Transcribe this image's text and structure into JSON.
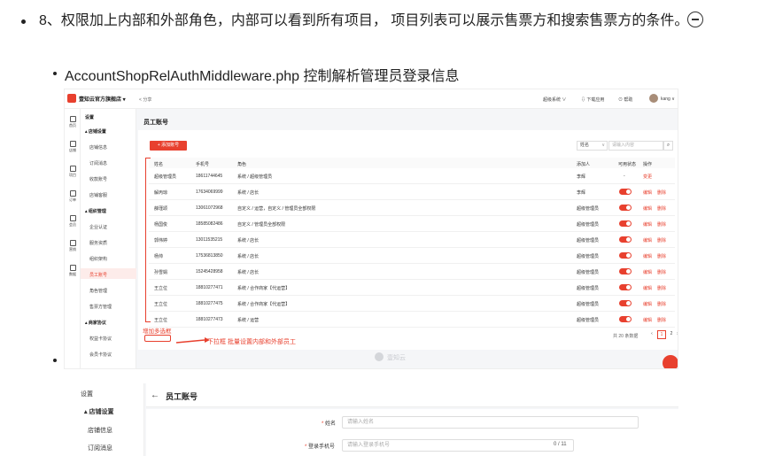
{
  "doc": {
    "item8_text": "8、权限加上内部和外部角色，内部可以看到所有项目， 项目列表可以展示售票方和搜索售票方的条件。",
    "item_sub_text": "AccountShopRelAuthMiddleware.php  控制解析管理员登录信息"
  },
  "shot1": {
    "shop_name": "壹知云官方旗舰店 ▾",
    "share": "分享",
    "top_right": [
      "超级系统 ∨",
      "下载应用",
      "帮助",
      "kang ∨"
    ],
    "icon_nav": [
      "首页",
      "店铺",
      "项目",
      "订单",
      "会员",
      "营销",
      "数据"
    ],
    "menu": {
      "title": "设置",
      "groups": [
        {
          "label": "▴ 店铺设置",
          "items": [
            "店铺信息",
            "订阅消息",
            "收款账号",
            "店铺客服"
          ]
        },
        {
          "label": "▴ 组织管理",
          "items": [
            "企业认证",
            "服务资质",
            "组织架构",
            "员工账号",
            "角色管理",
            "售票方管理"
          ]
        },
        {
          "label": "▴ 商家协议",
          "items": [
            "权益卡协议",
            "会员卡协议"
          ]
        }
      ],
      "active": "员工账号"
    },
    "page_title": "员工账号",
    "add_button": "+ 添加账号",
    "search_select": "姓名",
    "search_placeholder": "请输入内容",
    "columns": [
      "姓名",
      "手机号",
      "角色",
      "添加人",
      "可用状态",
      "操作"
    ],
    "rows": [
      {
        "name": "超级管理员",
        "phone": "18611744645",
        "role": "系统 / 超级管理员",
        "adder": "李辉",
        "status": "-",
        "actions": [
          "变更"
        ]
      },
      {
        "name": "解丙琼",
        "phone": "17634069999",
        "role": "系统 / 店长",
        "adder": "李辉",
        "status": "on",
        "actions": [
          "编辑",
          "删除"
        ]
      },
      {
        "name": "薛瑾颂",
        "phone": "13061072968",
        "role": "自定义 / 运营，自定义 / 管理员全部权限",
        "adder": "超级管理员",
        "status": "on",
        "actions": [
          "编辑",
          "删除"
        ]
      },
      {
        "name": "杨国俊",
        "phone": "18585082486",
        "role": "自定义 / 管理员全部权限",
        "adder": "超级管理员",
        "status": "on",
        "actions": [
          "编辑",
          "删除"
        ]
      },
      {
        "name": "郭伟婷",
        "phone": "13011535215",
        "role": "系统 / 店长",
        "adder": "超级管理员",
        "status": "on",
        "actions": [
          "编辑",
          "删除"
        ]
      },
      {
        "name": "杨帅",
        "phone": "17536813850",
        "role": "系统 / 店长",
        "adder": "超级管理员",
        "status": "on",
        "actions": [
          "编辑",
          "删除"
        ]
      },
      {
        "name": "孙雪娟",
        "phone": "15245428958",
        "role": "系统 / 店长",
        "adder": "超级管理员",
        "status": "on",
        "actions": [
          "编辑",
          "删除"
        ]
      },
      {
        "name": "王立位",
        "phone": "18810277471",
        "role": "系统 / 合作商家【代运营】",
        "adder": "超级管理员",
        "status": "on",
        "actions": [
          "编辑",
          "删除"
        ]
      },
      {
        "name": "王立位",
        "phone": "18810277475",
        "role": "系统 / 合作商家【代运营】",
        "adder": "超级管理员",
        "status": "on",
        "actions": [
          "编辑",
          "删除"
        ]
      },
      {
        "name": "王立位",
        "phone": "18810277473",
        "role": "系统 / 运营",
        "adder": "超级管理员",
        "status": "on",
        "actions": [
          "编辑",
          "删除"
        ]
      }
    ],
    "pager_total": "共 20 条数据",
    "pages": [
      "‹",
      "1",
      "2",
      "›"
    ],
    "current_page": "1",
    "watermark": "壹知云",
    "annotation_add_checkbox": "增加多选框",
    "annotation_dropdown": "下拉框 批量设置内部和外部员工"
  },
  "shot2": {
    "menu_title": "设置",
    "menu_group": "▴ 店铺设置",
    "menu_items": [
      "店铺信息",
      "订阅消息"
    ],
    "page_title": "员工账号",
    "name_label": "姓名",
    "name_placeholder": "请输入姓名",
    "phone_label": "登录手机号",
    "phone_placeholder": "请输入登录手机号",
    "phone_counter": "0 / 11"
  },
  "colors": {
    "accent": "#e8402e",
    "annotation": "#e8402e"
  }
}
